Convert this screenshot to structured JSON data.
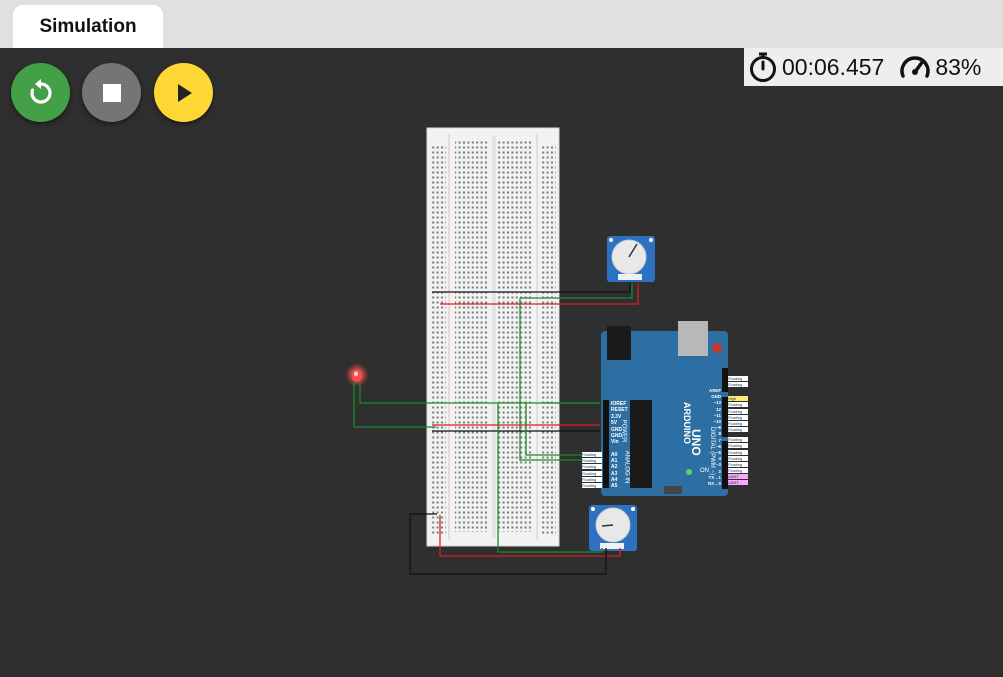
{
  "tab": {
    "label": "Simulation"
  },
  "controls": {
    "restart": {
      "icon": "restart-icon"
    },
    "stop": {
      "icon": "stop-icon"
    },
    "play": {
      "icon": "play-icon"
    }
  },
  "status": {
    "time": "00:06.457",
    "speed": "83%"
  },
  "colors": {
    "restart": "#43a047",
    "stop": "#757575",
    "play": "#fdd835",
    "board": "#2e6fa3",
    "wire_green": "#1b8a2a",
    "wire_red": "#d32020",
    "wire_black": "#111111"
  },
  "arduino": {
    "model": "UNO",
    "brand": "ARDUINO",
    "power_pins": [
      "IOREF",
      "RESET",
      "3.3V",
      "5V",
      "GND",
      "GND",
      "Vin"
    ],
    "analog_pins": [
      "A0",
      "A1",
      "A2",
      "A3",
      "A4",
      "A5"
    ],
    "digital_pins": [
      "AREF",
      "GND",
      "~13",
      "12",
      "~11",
      "~10",
      "~9",
      "8",
      "7",
      "~6",
      "~5",
      "4",
      "~3",
      "2",
      "TX→1",
      "RX←0"
    ],
    "section_power": "POWER",
    "section_analog": "ANALOG IN",
    "section_digital": "DIGITAL (PWM ~)",
    "on_label": "ON",
    "pin_states_analog": [
      "Floating",
      "Floating",
      "Floating",
      "Floating",
      "Floating",
      "Floating"
    ],
    "pin_states_digital": [
      "Floating",
      "Floating",
      "High",
      "Floating",
      "Floating",
      "Floating",
      "Floating",
      "Floating",
      "Floating",
      "Floating",
      "Floating",
      "Floating",
      "Floating",
      "Floating",
      "UART",
      "UART"
    ]
  }
}
